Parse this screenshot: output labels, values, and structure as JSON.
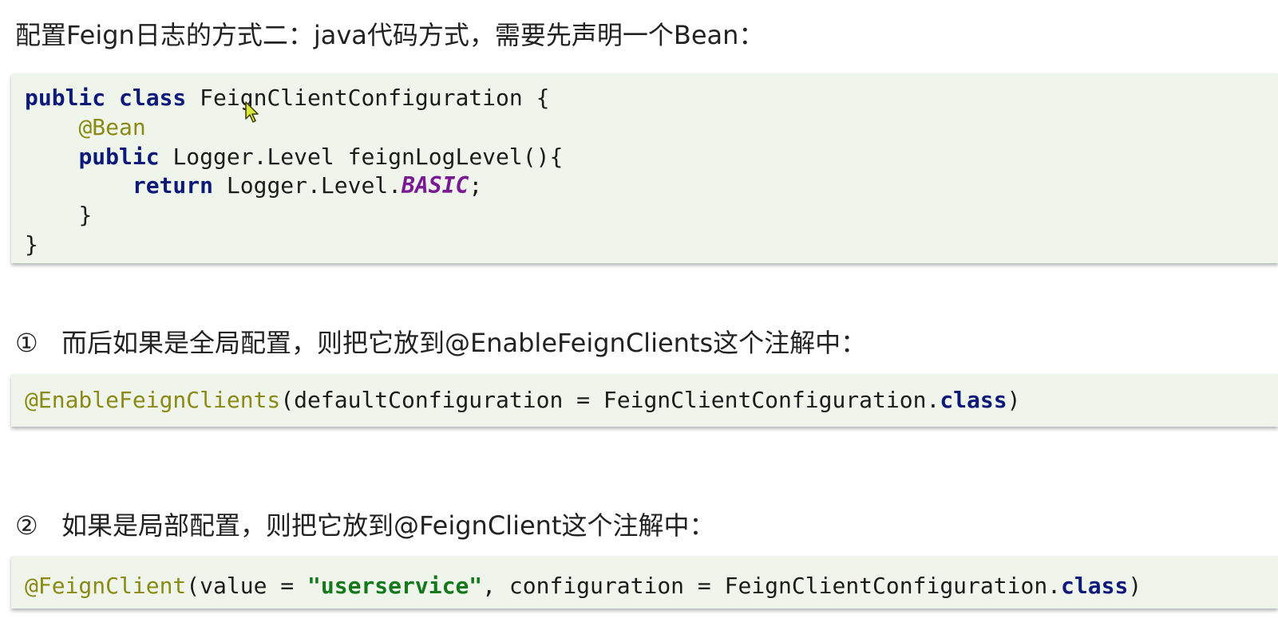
{
  "heading": "配置Feign日志的方式二：java代码方式，需要先声明一个Bean：",
  "config_class_code": {
    "line1": {
      "kw": "public class",
      "rest": " FeignClientConfiguration {"
    },
    "line2": {
      "annotation": "@Bean"
    },
    "line3": {
      "kw": "public",
      "rest": " Logger.Level feignLogLevel(){"
    },
    "line4": {
      "kw": "return",
      "mid": " Logger.Level.",
      "constant": "BASIC",
      "end": ";"
    },
    "line5": "}",
    "line6": "}"
  },
  "global_config": {
    "number": "①",
    "text": "而后如果是全局配置，则把它放到@EnableFeignClients这个注解中：",
    "code": {
      "annotation": "@EnableFeignClients",
      "mid": "(defaultConfiguration = FeignClientConfiguration.",
      "kw": "class",
      "end": ")"
    }
  },
  "local_config": {
    "number": "②",
    "text": "如果是局部配置，则把它放到@FeignClient这个注解中：",
    "code": {
      "annotation": "@FeignClient",
      "pre": "(value = ",
      "string": "\"userservice\"",
      "mid": ", configuration = FeignClientConfiguration.",
      "kw": "class",
      "end": ")"
    }
  },
  "colors": {
    "code_background": "#eff5ea",
    "keyword": "#0d1a7a",
    "annotation": "#8a8a14",
    "constant": "#7a1a94",
    "string": "#15781a"
  },
  "icons": {
    "cursor": "mouse-pointer-icon"
  }
}
